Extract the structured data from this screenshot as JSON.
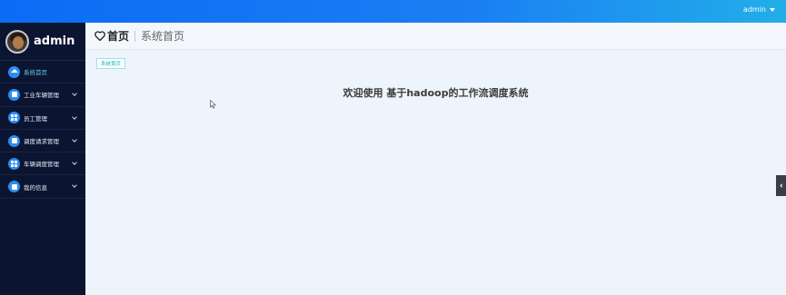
{
  "topbar": {
    "user_label": "admin"
  },
  "sidebar": {
    "profile_name": "admin",
    "items": [
      {
        "label": "系统首页",
        "icon": "home-icon"
      },
      {
        "label": "工业车辆管理",
        "icon": "chat-icon"
      },
      {
        "label": "员工管理",
        "icon": "grid-icon"
      },
      {
        "label": "调度请求管理",
        "icon": "briefcase-icon"
      },
      {
        "label": "车辆调度管理",
        "icon": "grid-icon"
      },
      {
        "label": "我的信息",
        "icon": "card-icon"
      }
    ]
  },
  "header": {
    "title": "首页",
    "breadcrumb": "系统首页"
  },
  "tabs": [
    {
      "label": "系统首页"
    }
  ],
  "main": {
    "welcome": "欢迎使用 基于hadoop的工作流调度系统"
  },
  "colors": {
    "accent": "#1a7ff3",
    "sidebar_bg": "#0b1430",
    "active_text": "#5fd2e8"
  }
}
